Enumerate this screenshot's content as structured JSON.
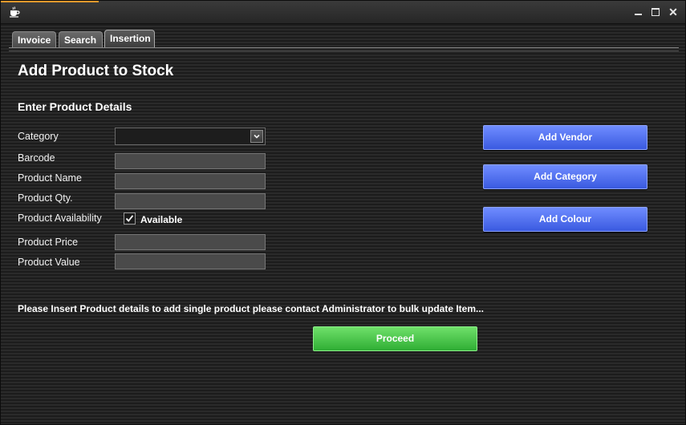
{
  "window": {
    "icons": {
      "app": "coffee-cup-icon",
      "minimize": "minimize-icon",
      "maximize": "maximize-icon",
      "close": "close-icon"
    },
    "close_glyph": "✕"
  },
  "tabs": [
    {
      "label": "Invoice",
      "active": false
    },
    {
      "label": "Search",
      "active": false
    },
    {
      "label": "Insertion",
      "active": true
    }
  ],
  "page": {
    "title": "Add Product to Stock",
    "section_title": "Enter Product Details"
  },
  "form": {
    "category": {
      "label": "Category",
      "value": ""
    },
    "barcode": {
      "label": "Barcode",
      "value": ""
    },
    "product_name": {
      "label": "Product Name",
      "value": ""
    },
    "product_qty": {
      "label": "Product Qty.",
      "value": ""
    },
    "availability": {
      "label": "Product Availability",
      "checkbox_label": "Available",
      "checked": true
    },
    "product_price": {
      "label": "Product Price",
      "value": ""
    },
    "product_value": {
      "label": "Product Value",
      "value": ""
    }
  },
  "actions": {
    "add_vendor": "Add Vendor",
    "add_category": "Add Category",
    "add_colour": "Add Colour",
    "proceed": "Proceed"
  },
  "notice": "Please Insert Product details to add single product please contact Administrator to bulk update Item...",
  "colors": {
    "accent": "#e79a2c",
    "action_blue": "#4a6af0",
    "proceed_green": "#3cc23e"
  }
}
